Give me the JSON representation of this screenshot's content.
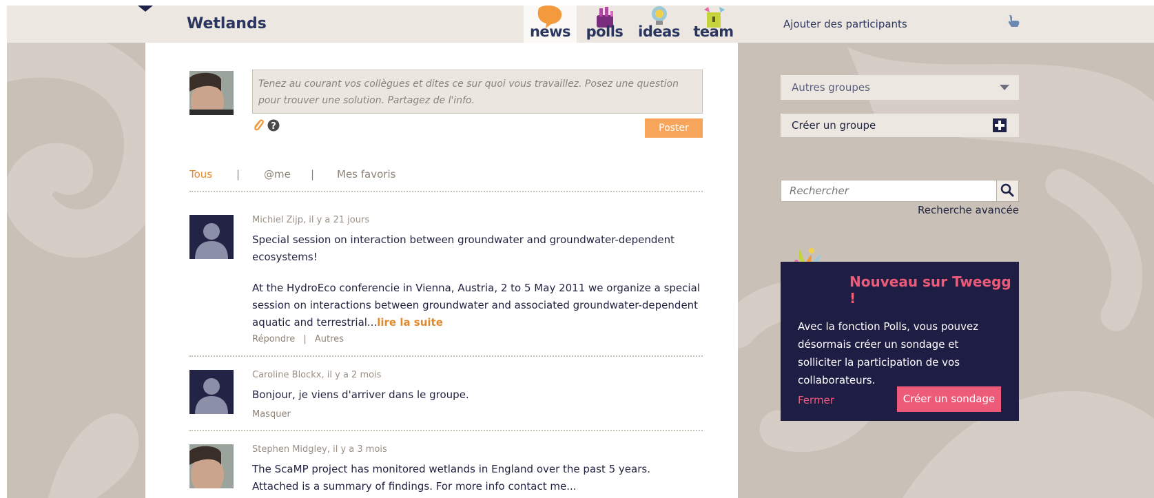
{
  "header": {
    "group_title": "Wetlands",
    "tabs": [
      {
        "label": "news",
        "active": true
      },
      {
        "label": "polls",
        "active": false
      },
      {
        "label": "ideas",
        "active": false
      },
      {
        "label": "team",
        "active": false
      }
    ],
    "add_participants": "Ajouter des participants"
  },
  "composer": {
    "placeholder": "Tenez au courant vos collègues et dites ce sur quoi vous travaillez. Posez une question pour trouver une solution. Partagez de l'info.",
    "post_label": "Poster"
  },
  "filters": {
    "all": "Tous",
    "me": "@me",
    "favorites": "Mes favoris",
    "separator": "|"
  },
  "feed": [
    {
      "meta": "Michiel Zijp, il y a 21 jours",
      "para1": "Special session on interaction between groundwater and groundwater-dependent ecosystems!",
      "para2": "At the HydroEco conferencie in Vienna, Austria, 2 to 5 May 2011 we organize a special session on interactions between groundwater and associated groundwater-dependent aquatic and terrestrial...",
      "read_more": "lire la suite",
      "reply": "Répondre",
      "sep": "|",
      "other": "Autres"
    },
    {
      "meta": "Caroline Blockx, il y a 2 mois",
      "body": "Bonjour, je viens d'arriver dans le groupe.",
      "hide": "Masquer"
    },
    {
      "meta": "Stephen Midgley, il y a 3 mois",
      "body": "The ScaMP project has monitored wetlands in England over the past 5 years. Attached is a summary of findings. For more info contact me..."
    }
  ],
  "sidebar": {
    "other_groups": "Autres groupes",
    "create_group": "Créer un groupe",
    "search_placeholder": "Rechercher",
    "advanced_search": "Recherche avancée",
    "promo": {
      "title": "Nouveau sur Tweegg !",
      "text": "Avec la fonction Polls, vous pouvez désormais créer un sondage et solliciter la participation de vos collaborateurs.",
      "close": "Fermer",
      "cta": "Créer un sondage"
    }
  },
  "colors": {
    "navy": "#1e2148",
    "orange": "#f6a55b",
    "pink": "#ee5b79",
    "background": "#c9c0b7"
  }
}
